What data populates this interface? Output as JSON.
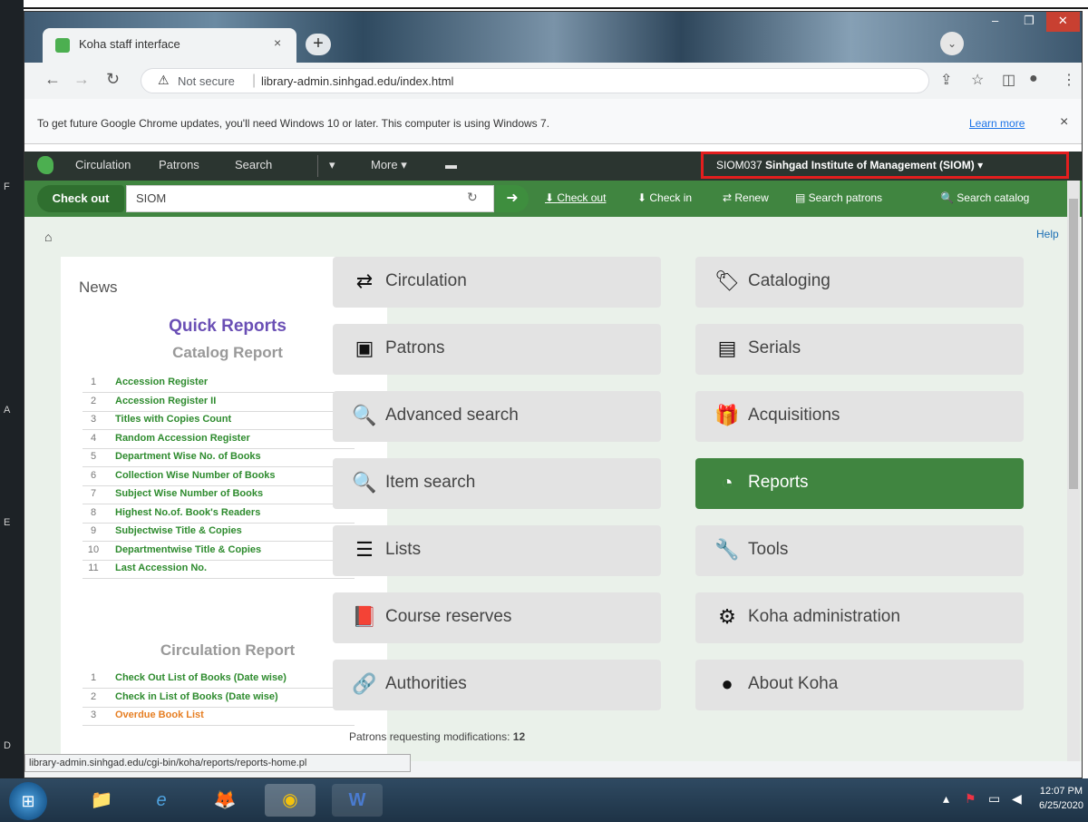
{
  "desktop": {
    "edge_letters": [
      "F",
      "A",
      "E",
      "D"
    ]
  },
  "browser": {
    "tab_title": "Koha staff interface",
    "tab_close": "×",
    "new_tab": "+",
    "window_buttons": [
      "‒",
      "❐",
      "✕"
    ],
    "not_secure": "Not secure",
    "url": "library-admin.sinhgad.edu/index.html",
    "infobar_text": "To get future Google Chrome updates, you'll need Windows 10 or later. This computer is using Windows 7.",
    "learn_more": "Learn more",
    "infobar_close": "×",
    "status_url": "library-admin.sinhgad.edu/cgi-bin/koha/reports/reports-home.pl"
  },
  "koha_nav": {
    "items": [
      "Circulation",
      "Patrons",
      "Search",
      "▾",
      "More ▾"
    ],
    "cart_icon": "cart-icon",
    "user_id": "SIOM037",
    "library_name": "Sinhgad Institute of Management (SIOM)",
    "library_caret": "▾"
  },
  "search_bar": {
    "mode_label": "Check out",
    "input_value": "SIOM",
    "quick_links": [
      "Check out",
      "Check in",
      "Renew",
      "Search patrons",
      "Search catalog"
    ]
  },
  "page": {
    "help": "Help",
    "news_title": "News",
    "quick_reports_title": "Quick Reports",
    "catalog_section": "Catalog Report",
    "catalog_reports": [
      {
        "num": "1",
        "label": "Accession Register"
      },
      {
        "num": "2",
        "label": "Accession Register II"
      },
      {
        "num": "3",
        "label": "Titles with Copies Count"
      },
      {
        "num": "4",
        "label": "Random Accession Register"
      },
      {
        "num": "5",
        "label": "Department Wise No. of Books"
      },
      {
        "num": "6",
        "label": "Collection Wise Number of Books"
      },
      {
        "num": "7",
        "label": "Subject Wise Number of Books"
      },
      {
        "num": "8",
        "label": "Highest No.of. Book's Readers"
      },
      {
        "num": "9",
        "label": "Subjectwise Title & Copies"
      },
      {
        "num": "10",
        "label": "Departmentwise Title & Copies"
      },
      {
        "num": "11",
        "label": "Last Accession No."
      }
    ],
    "circulation_section": "Circulation Report",
    "circulation_reports": [
      {
        "num": "1",
        "label": "Check Out List of Books (Date wise)"
      },
      {
        "num": "2",
        "label": "Check in List of Books (Date wise)"
      },
      {
        "num": "3",
        "label": "Overdue Book List"
      }
    ],
    "tiles_left": [
      {
        "icon": "⇄",
        "label": "Circulation"
      },
      {
        "icon": "▣",
        "label": "Patrons"
      },
      {
        "icon": "🔍",
        "label": "Advanced search"
      },
      {
        "icon": "🔍",
        "label": "Item search"
      },
      {
        "icon": "☰",
        "label": "Lists"
      },
      {
        "icon": "📕",
        "label": "Course reserves"
      },
      {
        "icon": "🔗",
        "label": "Authorities"
      }
    ],
    "tiles_right": [
      {
        "icon": "🏷",
        "label": "Cataloging"
      },
      {
        "icon": "▤",
        "label": "Serials"
      },
      {
        "icon": "🎁",
        "label": "Acquisitions"
      },
      {
        "icon": "◔",
        "label": "Reports"
      },
      {
        "icon": "🔧",
        "label": "Tools"
      },
      {
        "icon": "⚙",
        "label": "Koha administration"
      },
      {
        "icon": "●",
        "label": "About Koha"
      }
    ],
    "pending_label": "Patrons requesting modifications:",
    "pending_count": "12"
  },
  "taskbar": {
    "apps": [
      "📁",
      "e",
      "🦊",
      "◉",
      "W"
    ],
    "time": "12:07 PM",
    "date": "6/25/2020"
  },
  "colors": {
    "koha_green": "#408540",
    "koha_nav_dark": "#2b3530",
    "highlight_red": "#e41e1e",
    "report_link_green": "#2e8b2e",
    "report_link_orange": "#e67e22"
  }
}
